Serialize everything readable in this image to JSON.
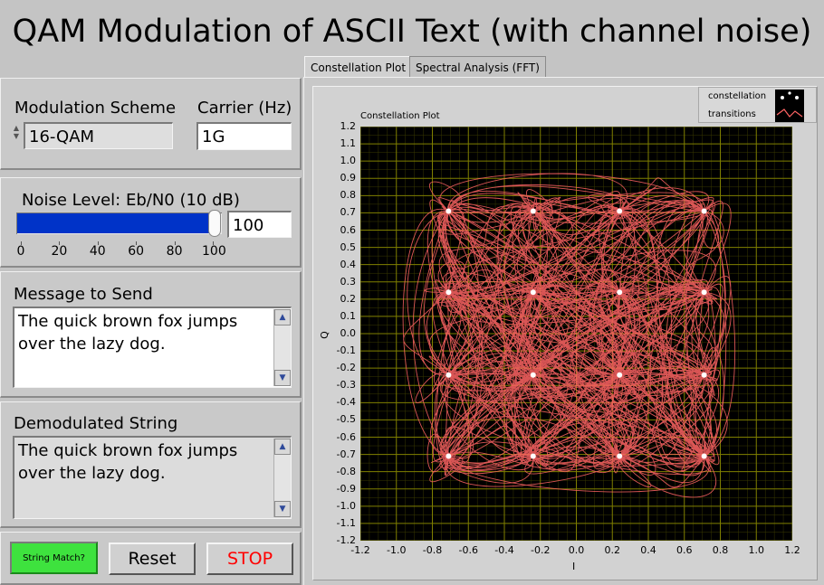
{
  "title": "QAM Modulation of ASCII Text (with channel noise)",
  "modulation": {
    "label": "Modulation Scheme",
    "value": "16-QAM"
  },
  "carrier": {
    "label": "Carrier (Hz)",
    "value": "1G"
  },
  "noise": {
    "label": "Noise Level: Eb/N0 (10 dB)",
    "value": "100",
    "level": 100,
    "ticks": [
      "0",
      "20",
      "40",
      "60",
      "80",
      "100"
    ]
  },
  "message": {
    "label": "Message to Send",
    "text": "The quick brown fox jumps\nover the lazy dog."
  },
  "demod": {
    "label": "Demodulated String",
    "text": "The quick brown fox jumps\nover the lazy dog."
  },
  "buttons": {
    "string_match": "String Match?",
    "reset": "Reset",
    "stop": "STOP"
  },
  "tabs": [
    "Constellation Plot",
    "Spectral Analysis (FFT)"
  ],
  "legend": {
    "constellation": "constellation",
    "transitions": "transitions"
  },
  "colors": {
    "plot_bg": "#000000",
    "grid": "#7f7f00",
    "trace": "#ff6464",
    "point": "#ffffff",
    "slider_fill": "#0033c8",
    "led_on": "#3ee23e",
    "stop_text": "#ff0000"
  },
  "chart_data": {
    "type": "scatter",
    "title": "Constellation Plot",
    "xlabel": "I",
    "ylabel": "Q",
    "xlim": [
      -1.2,
      1.2
    ],
    "ylim": [
      -1.2,
      1.2
    ],
    "xticks": [
      "-1.2",
      "-1.0",
      "-0.8",
      "-0.6",
      "-0.4",
      "-0.2",
      "0.0",
      "0.2",
      "0.4",
      "0.6",
      "0.8",
      "1.0",
      "1.2"
    ],
    "yticks": [
      "1.2",
      "1.1",
      "1.0",
      "0.9",
      "0.8",
      "0.7",
      "0.6",
      "0.5",
      "0.4",
      "0.3",
      "0.2",
      "0.1",
      "0.0",
      "-0.1",
      "-0.2",
      "-0.3",
      "-0.4",
      "-0.5",
      "-0.6",
      "-0.7",
      "-0.8",
      "-0.9",
      "-1.0",
      "-1.1",
      "-1.2"
    ],
    "grid": true,
    "legend_position": "top-right",
    "series": [
      {
        "name": "constellation",
        "points": [
          [
            -0.71,
            0.71
          ],
          [
            -0.24,
            0.71
          ],
          [
            0.24,
            0.71
          ],
          [
            0.71,
            0.71
          ],
          [
            -0.71,
            0.24
          ],
          [
            -0.24,
            0.24
          ],
          [
            0.24,
            0.24
          ],
          [
            0.71,
            0.24
          ],
          [
            -0.71,
            -0.24
          ],
          [
            -0.24,
            -0.24
          ],
          [
            0.24,
            -0.24
          ],
          [
            0.71,
            -0.24
          ],
          [
            -0.71,
            -0.71
          ],
          [
            -0.24,
            -0.71
          ],
          [
            0.24,
            -0.71
          ],
          [
            0.71,
            -0.71
          ]
        ]
      },
      {
        "name": "transitions"
      }
    ]
  }
}
